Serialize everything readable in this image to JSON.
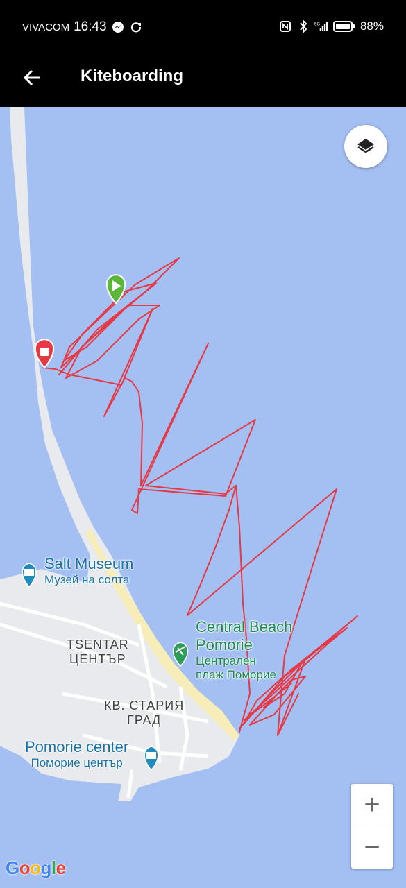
{
  "status_bar": {
    "carrier": "VIVACOM",
    "time": "16:43",
    "battery": "88%",
    "icons": [
      "messenger-icon",
      "sync-icon",
      "nfc-icon",
      "bluetooth-icon",
      "signal-5g-icon",
      "battery-icon"
    ]
  },
  "app_bar": {
    "title": "Kiteboarding",
    "back_icon": "arrow-left-icon"
  },
  "map": {
    "layers_icon": "layers-icon",
    "zoom_in": "+",
    "zoom_out": "−",
    "start_marker": "play-marker",
    "end_marker": "stop-marker",
    "track_color": "#e53945",
    "water_color": "#a4bff2",
    "places": {
      "salt_museum": {
        "name": "Salt Museum",
        "local": "Музей на солта"
      },
      "central_beach": {
        "name_line1": "Central Beach",
        "name_line2": "Pomorie",
        "local_line1": "Централен",
        "local_line2": "плаж Поморие"
      },
      "tsentar": {
        "line1": "TSENTAR",
        "line2": "ЦЕНТЪР"
      },
      "stariya_grad": {
        "line1": "КВ. СТАРИЯ",
        "line2": "ГРАД"
      },
      "pomorie_center": {
        "name": "Pomorie center",
        "local": "Поморие център"
      }
    },
    "attribution": "Google"
  }
}
